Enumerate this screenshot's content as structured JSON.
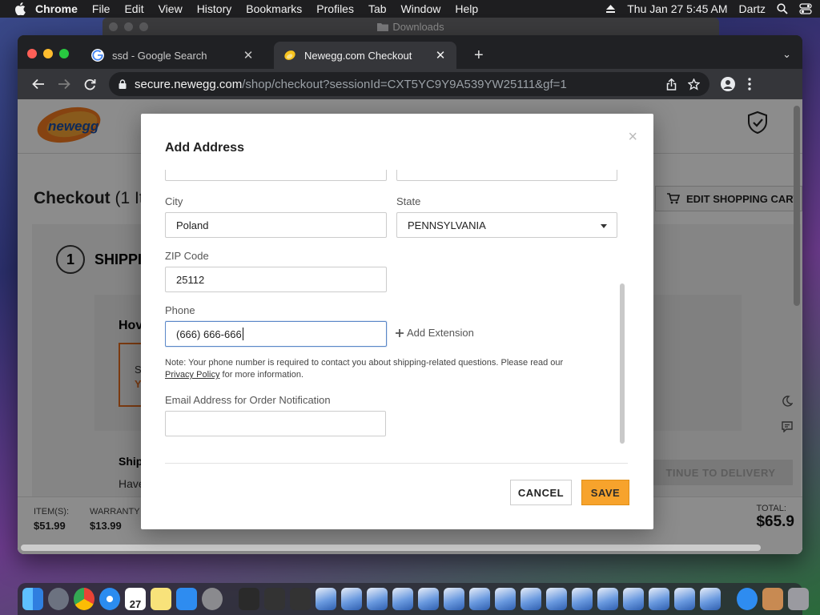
{
  "menubar": {
    "app_name": "Chrome",
    "items": [
      "File",
      "Edit",
      "View",
      "History",
      "Bookmarks",
      "Profiles",
      "Tab",
      "Window",
      "Help"
    ],
    "datetime": "Thu Jan 27  5:45 AM",
    "user": "Dartz"
  },
  "background_window": {
    "title": "Downloads"
  },
  "browser": {
    "tabs": [
      {
        "title": "ssd - Google Search",
        "active": false
      },
      {
        "title": "Newegg.com Checkout",
        "active": true
      }
    ],
    "url": {
      "host": "secure.newegg.com",
      "path": "/shop/checkout?sessionId=CXT5YC9Y9A539YW25111&gf=1"
    }
  },
  "page": {
    "logo_text": "newegg",
    "checkout_title": "Checkout",
    "checkout_count": " (1 It",
    "edit_cart_label": "EDIT SHOPPING CART",
    "step_number": "1",
    "step_label": "SHIPPI",
    "how_label": "Hov",
    "orange_box_text": "S",
    "orange_box_text2": "Y",
    "shipping_label": "Ship",
    "have_label": "Have",
    "continue_label": "TINUE TO DELIVERY",
    "footer": {
      "items_label": "ITEM(S):",
      "items_value": "$51.99",
      "warranty_label": "WARRANTY &",
      "warranty_value": "$13.99",
      "total_label": "TOTAL:",
      "total_value": "$65.9"
    }
  },
  "modal": {
    "title": "Add Address",
    "close": "×",
    "city": {
      "label": "City",
      "value": "Poland"
    },
    "state": {
      "label": "State",
      "value": "PENNSYLVANIA"
    },
    "zip": {
      "label": "ZIP Code",
      "value": "25112"
    },
    "phone": {
      "label": "Phone",
      "value": "(666) 666-666"
    },
    "add_extension": "Add Extension",
    "note_prefix": "Note: Your phone number is required to contact you about shipping-related questions. Please read our",
    "note_link": "Privacy Policy",
    "note_suffix": "for more information.",
    "email": {
      "label": "Email Address for Order Notification",
      "value": ""
    },
    "cancel_label": "CANCEL",
    "save_label": "SAVE"
  },
  "dock": {
    "calendar_day": "27"
  },
  "colors": {
    "save_button": "#f7a32c",
    "focus_border": "#5b88c8",
    "newegg_orange": "#f47b20",
    "newegg_blue": "#1a4ea2"
  }
}
